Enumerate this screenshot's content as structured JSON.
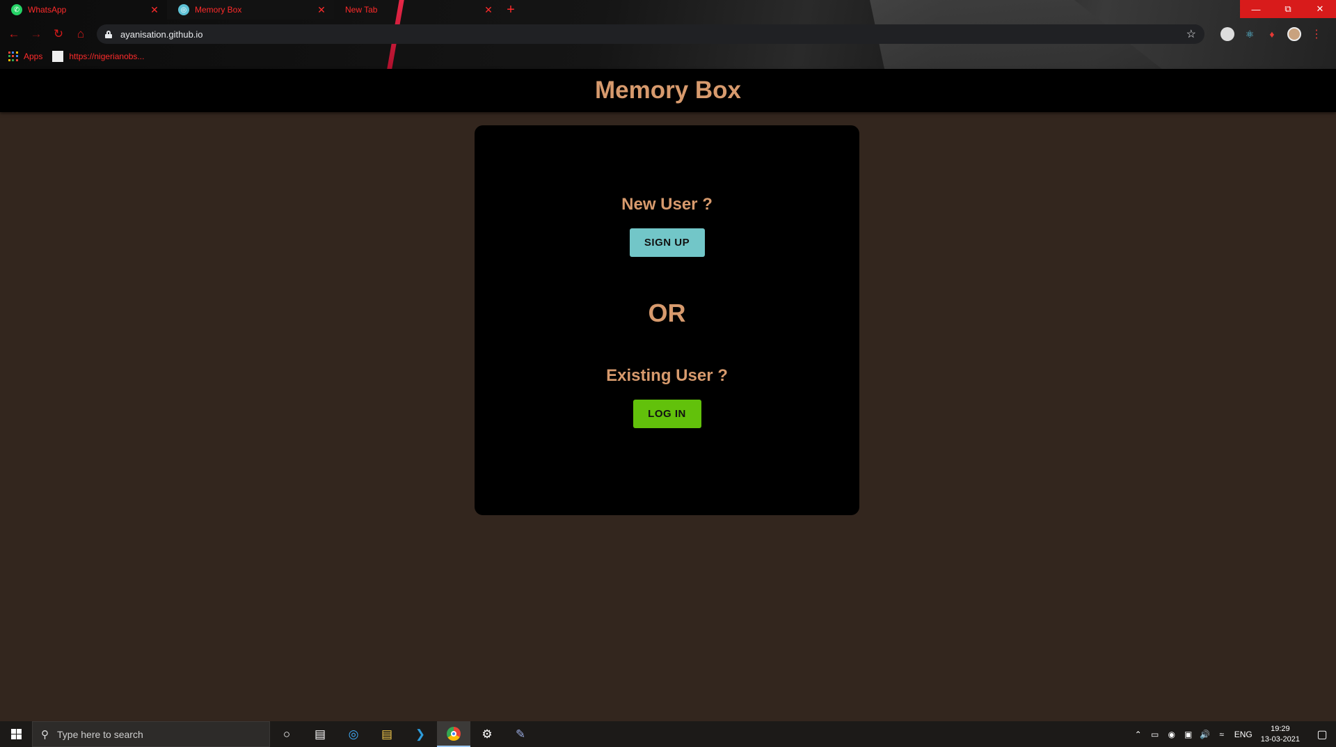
{
  "browser": {
    "tabs": [
      {
        "title": "WhatsApp",
        "icon": "whatsapp-icon",
        "icon_color": "#25d366",
        "active": false
      },
      {
        "title": "Memory Box",
        "icon": "globe-icon",
        "icon_color": "#5ec2d6",
        "active": true
      },
      {
        "title": "New Tab",
        "icon": "",
        "icon_color": "",
        "active": false
      }
    ],
    "new_tab_symbol": "+",
    "url": "ayanisation.github.io",
    "bookmarks": [
      {
        "label": "Apps"
      },
      {
        "label": "https://nigerianobs..."
      }
    ],
    "accent_color": "#ff2b2b"
  },
  "app": {
    "title": "Memory Box",
    "new_user_prompt": "New User ?",
    "signup_label": "SIGN UP",
    "or_label": "OR",
    "existing_user_prompt": "Existing User ?",
    "login_label": "LOG IN",
    "colors": {
      "background": "#33261e",
      "card": "#000000",
      "text_accent": "#d79a6d",
      "signup_button": "#72c6c8",
      "login_button": "#62c10b"
    }
  },
  "taskbar": {
    "search_placeholder": "Type here to search",
    "language": "ENG",
    "time": "19:29",
    "date": "13-03-2021"
  }
}
